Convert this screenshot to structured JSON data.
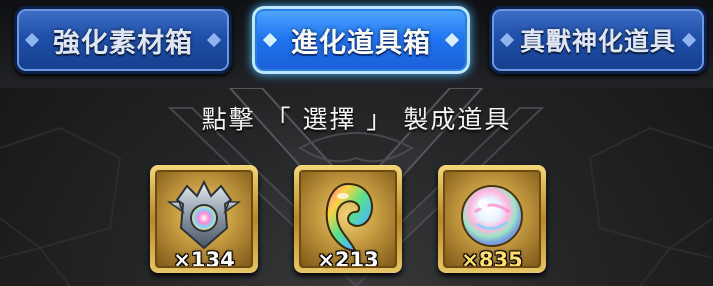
{
  "tabs": [
    {
      "label": "強化素材箱",
      "active": false
    },
    {
      "label": "進化道具箱",
      "active": true
    },
    {
      "label": "真獸神化道具",
      "active": false
    }
  ],
  "instruction": "點擊 「 選擇 」 製成道具",
  "items": [
    {
      "icon": "shield-crest-icon",
      "count": "×134",
      "count_color": "#ffffff"
    },
    {
      "icon": "rainbow-tear-icon",
      "count": "×213",
      "count_color": "#ffffff"
    },
    {
      "icon": "rainbow-orb-icon",
      "count": "×835",
      "count_color": "#ffe066"
    }
  ],
  "colors": {
    "tab_active": "#1f72f0",
    "tab_inactive": "#1f4fa8",
    "slot_frame": "#d8b04e",
    "background": "#242526"
  }
}
